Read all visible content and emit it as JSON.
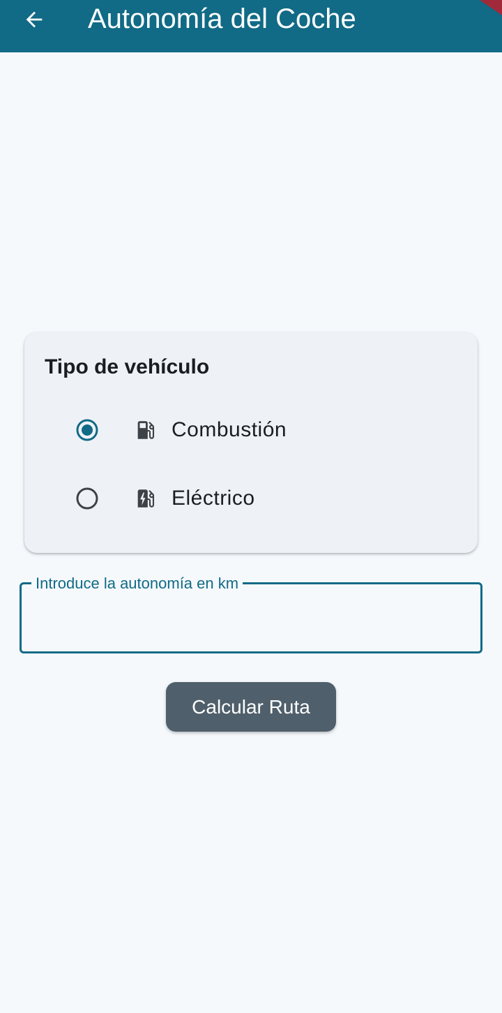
{
  "appbar": {
    "title": "Autonomía del Coche",
    "back_icon": "arrow-back-icon",
    "background": "#116a86"
  },
  "vehicle_card": {
    "title": "Tipo de vehículo",
    "options": [
      {
        "label": "Combustión",
        "icon": "gas-station-icon",
        "selected": true
      },
      {
        "label": "Eléctrico",
        "icon": "ev-station-icon",
        "selected": false
      }
    ]
  },
  "range_field": {
    "label": "Introduce la autonomía en km",
    "value": ""
  },
  "calculate_button": {
    "label": "Calcular Ruta"
  },
  "colors": {
    "primary": "#116a86",
    "background": "#f5f9fc",
    "card": "#eef2f7",
    "button": "#4f5f6b",
    "text": "#1b1d20"
  }
}
